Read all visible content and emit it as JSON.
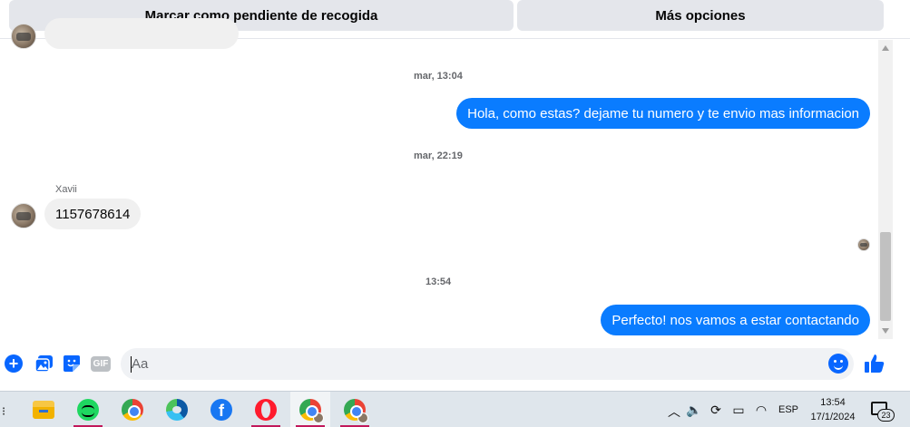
{
  "topbar": {
    "mark_pending_label": "Marcar como pendiente de recogida",
    "more_options_label": "Más opciones"
  },
  "conversation": {
    "timestamps": [
      "mar, 13:04",
      "mar, 22:19",
      "13:54"
    ],
    "messages": [
      {
        "direction": "outgoing",
        "text": "Hola, como estas? dejame tu numero y te envio mas informacion"
      },
      {
        "direction": "incoming",
        "sender": "Xavii",
        "text": "1157678614"
      },
      {
        "direction": "outgoing",
        "text": "Perfecto! nos vamos a estar contactando"
      }
    ]
  },
  "composer": {
    "placeholder": "Aa",
    "gif_label": "GIF",
    "icons": [
      "plus-icon",
      "photo-icon",
      "sticker-icon",
      "gif-icon",
      "emoji-icon",
      "thumbs-up-icon"
    ]
  },
  "taskbar": {
    "apps": [
      "file-explorer",
      "spotify",
      "chrome",
      "edge",
      "facebook",
      "opera",
      "chrome-profile-1",
      "chrome-profile-2"
    ],
    "language": "ESP",
    "time": "13:54",
    "date": "17/1/2024",
    "notification_count": "23",
    "facebook_glyph": "f"
  },
  "colors": {
    "messenger_blue": "#0a7cff",
    "accent": "#0866ff",
    "incoming_bubble": "#f0f0f0",
    "taskbar": "#dfe6ec"
  }
}
